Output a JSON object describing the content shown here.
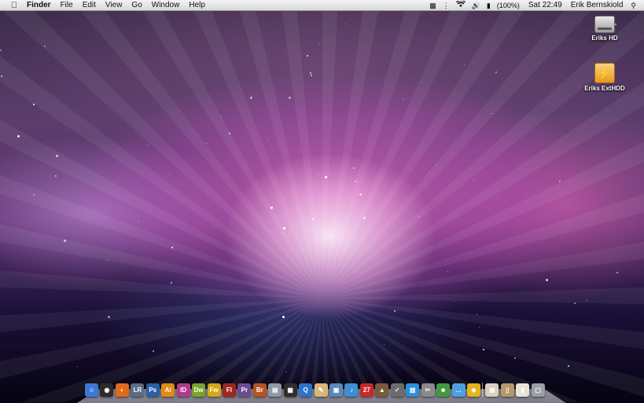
{
  "menubar": {
    "apple_icon": "apple-icon",
    "app_name": "Finder",
    "menus": [
      "File",
      "Edit",
      "View",
      "Go",
      "Window",
      "Help"
    ],
    "status": {
      "battery": "(100%)",
      "clock": "Sat 22:49",
      "user": "Erik Bernskiold"
    }
  },
  "desktop": {
    "icons": [
      {
        "label": "Eriks HD",
        "icon": "hard-drive-icon"
      },
      {
        "label": "Eriks ExtHDD",
        "icon": "external-drive-icon"
      }
    ]
  },
  "dock": {
    "items": [
      {
        "name": "finder",
        "glyph": "☺",
        "color": "#3a79d6"
      },
      {
        "name": "dashboard",
        "glyph": "◉",
        "color": "#2b2b2b"
      },
      {
        "name": "firefox",
        "glyph": "◐",
        "color": "#e06a1b"
      },
      {
        "name": "lightroom",
        "glyph": "LR",
        "color": "#5a6d86"
      },
      {
        "name": "photoshop",
        "glyph": "Ps",
        "color": "#2a5fa7"
      },
      {
        "name": "illustrator",
        "glyph": "Ai",
        "color": "#e28a14"
      },
      {
        "name": "indesign",
        "glyph": "ID",
        "color": "#b23a8c"
      },
      {
        "name": "dreamweaver",
        "glyph": "Dw",
        "color": "#7aa32a"
      },
      {
        "name": "fireworks",
        "glyph": "Fw",
        "color": "#d6a614"
      },
      {
        "name": "flash",
        "glyph": "Fl",
        "color": "#a0261f"
      },
      {
        "name": "premiere",
        "glyph": "Pr",
        "color": "#6d4b94"
      },
      {
        "name": "bridge",
        "glyph": "Br",
        "color": "#b8541e"
      },
      {
        "name": "trash-folder",
        "glyph": "▤",
        "color": "#8e9aa6"
      },
      {
        "name": "clapperboard",
        "glyph": "▦",
        "color": "#2e2e2e"
      },
      {
        "name": "quicktime",
        "glyph": "Q",
        "color": "#2d73c9"
      },
      {
        "name": "textedit",
        "glyph": "✎",
        "color": "#d9b67a"
      },
      {
        "name": "preview",
        "glyph": "▣",
        "color": "#5c87b8"
      },
      {
        "name": "itunes",
        "glyph": "♪",
        "color": "#3c8ed6"
      },
      {
        "name": "ical",
        "glyph": "27",
        "color": "#c62a2a"
      },
      {
        "name": "keynote",
        "glyph": "▲",
        "color": "#7a5a3a"
      },
      {
        "name": "script-editor",
        "glyph": "✓",
        "color": "#6c6c6c"
      },
      {
        "name": "chart",
        "glyph": "▥",
        "color": "#2b8fd6"
      },
      {
        "name": "utilities",
        "glyph": "✂",
        "color": "#8a8a8a"
      },
      {
        "name": "accounts",
        "glyph": "☻",
        "color": "#3f9a3f"
      },
      {
        "name": "ichat",
        "glyph": "…",
        "color": "#4aa0e0"
      },
      {
        "name": "adium",
        "glyph": "◆",
        "color": "#e2b51a"
      },
      {
        "name": "documents",
        "glyph": "▤",
        "color": "#d8d0bc"
      },
      {
        "name": "downloads",
        "glyph": "▯",
        "color": "#b89868"
      },
      {
        "name": "stack",
        "glyph": "▮",
        "color": "#e8e4d8"
      },
      {
        "name": "trash",
        "glyph": "▢",
        "color": "#9aa0a6"
      }
    ]
  }
}
